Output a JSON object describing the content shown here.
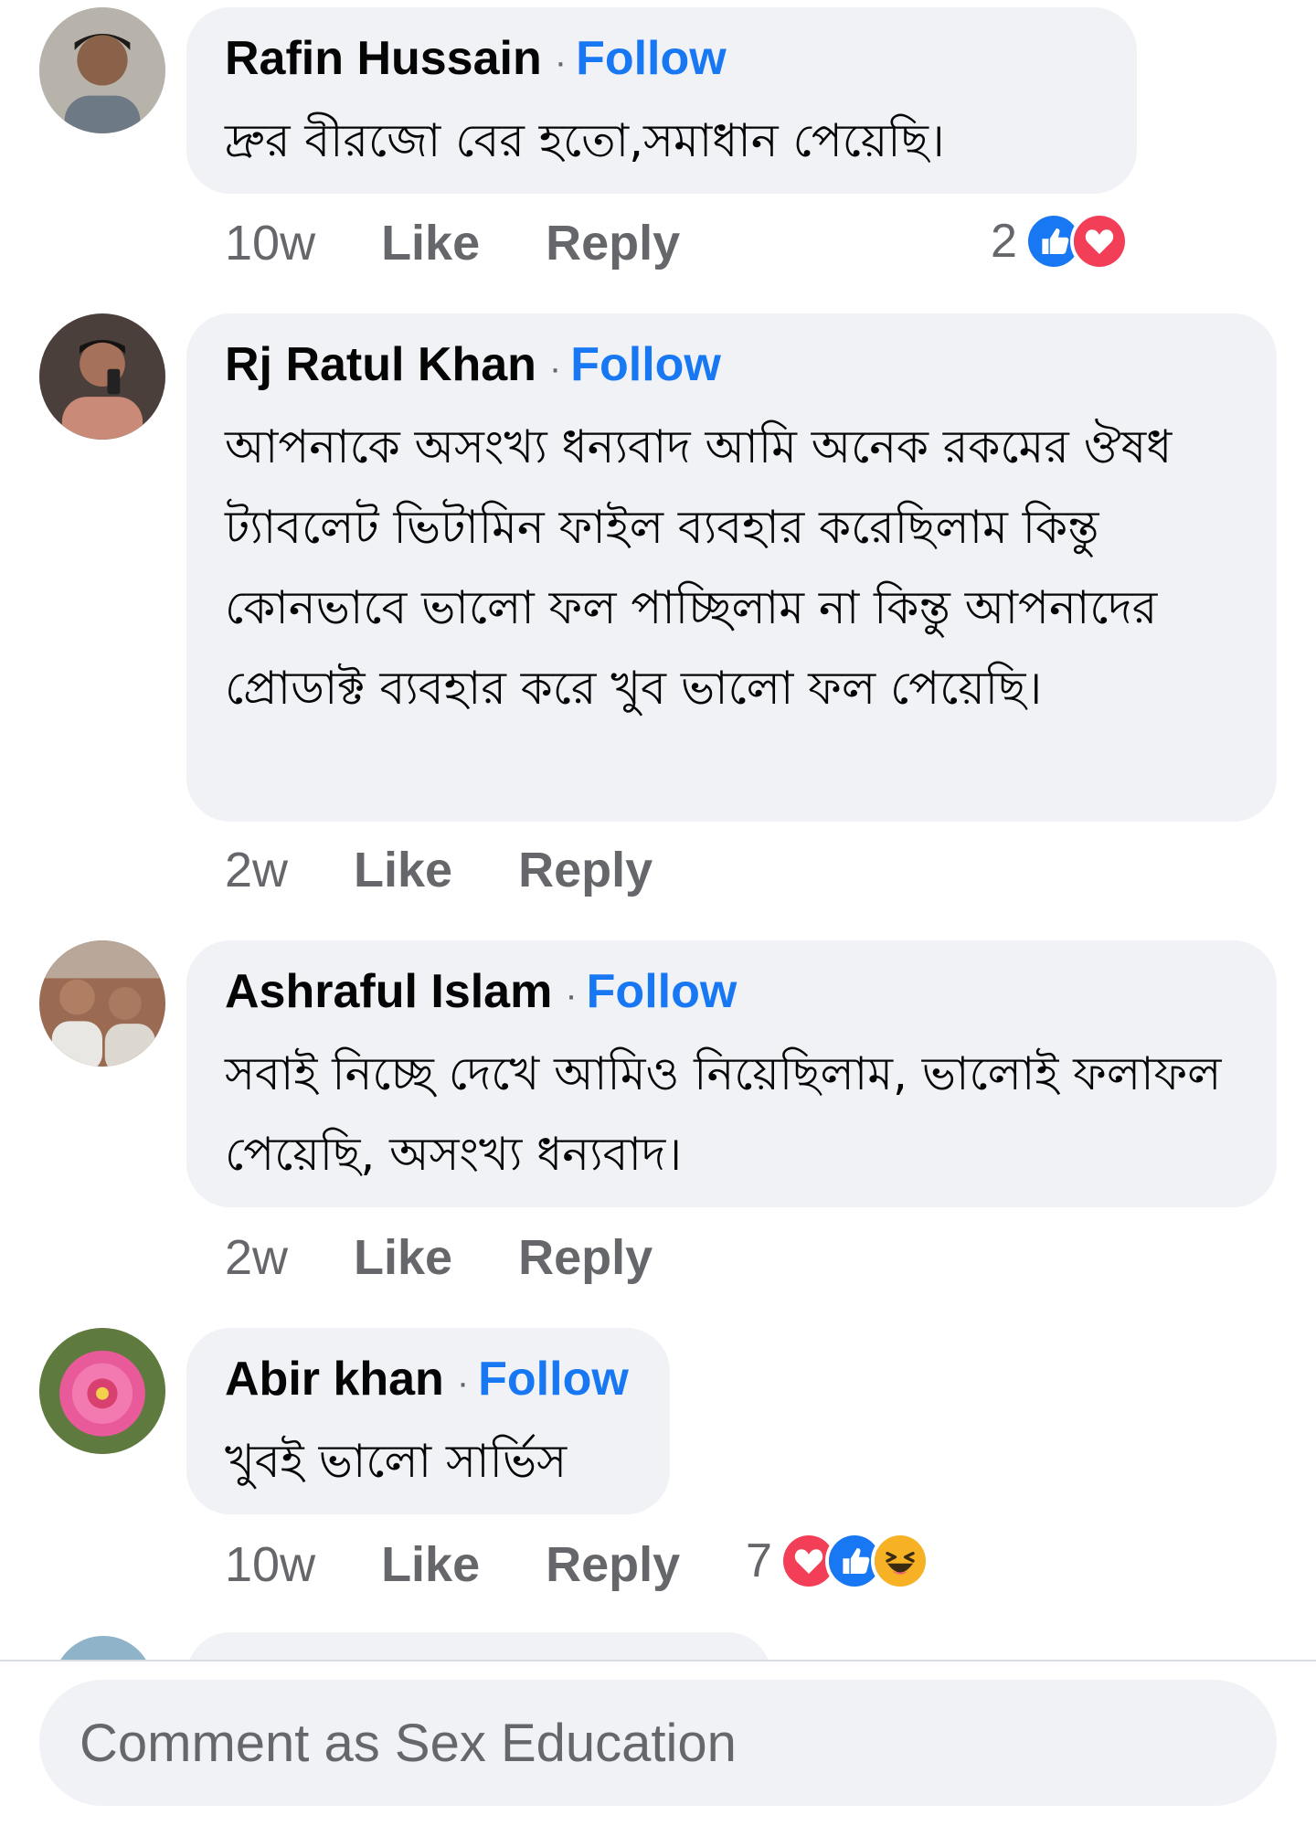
{
  "comments": [
    {
      "name": "Rafin Hussain",
      "follow": "Follow",
      "separator": "·",
      "text": "দ্রুর বীরজো বের হতো,সমাধান পেয়েছি।",
      "time": "10w",
      "like": "Like",
      "reply": "Reply",
      "reaction_count": "2",
      "reactions": [
        "like-icon",
        "love-icon"
      ]
    },
    {
      "name": "Rj Ratul Khan",
      "follow": "Follow",
      "separator": "·",
      "text": "আপনাকে অসংখ্য ধন্যবাদ আমি অনেক রকমের ঔষধ ট্যাবলেট ভিটামিন ফাইল ব্যবহার করেছিলাম কিন্তু কোনভাবে ভালো ফল পাচ্ছিলাম না কিন্তু আপনাদের প্রোডাক্ট ব্যবহার করে খুব ভালো ফল পেয়েছি।",
      "time": "2w",
      "like": "Like",
      "reply": "Reply"
    },
    {
      "name": "Ashraful Islam",
      "follow": "Follow",
      "separator": "·",
      "text": "সবাই নিচ্ছে দেখে আমিও নিয়েছিলাম, ভালোই ফলাফল পেয়েছি, অসংখ্য ধন্যবাদ।",
      "time": "2w",
      "like": "Like",
      "reply": "Reply"
    },
    {
      "name": "Abir khan",
      "follow": "Follow",
      "separator": "·",
      "text": "খুবই ভালো সার্ভিস",
      "time": "10w",
      "like": "Like",
      "reply": "Reply",
      "reaction_count": "7",
      "reactions": [
        "love-icon",
        "like-icon",
        "haha-icon"
      ]
    }
  ],
  "composer": {
    "placeholder": "Comment as Sex Education"
  },
  "colors": {
    "accent": "#1877f2",
    "bubble": "#f0f2f5",
    "muted": "#65676b",
    "love": "#f33e58",
    "haha": "#f7b125"
  }
}
